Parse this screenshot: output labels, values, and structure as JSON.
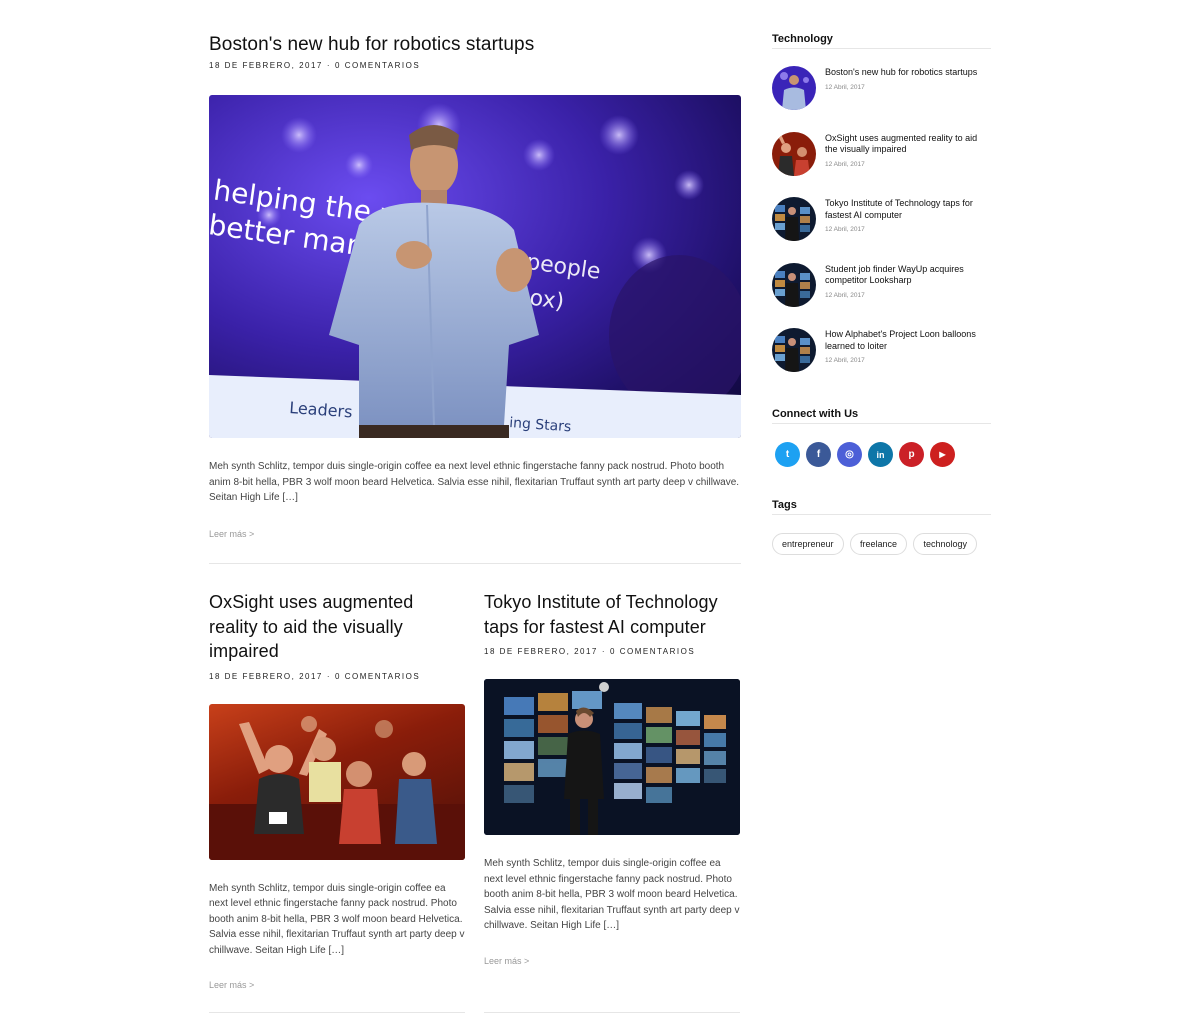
{
  "featured": {
    "title": "Boston's new hub for robotics startups",
    "date": "18 de febrero, 2017",
    "separator": "·",
    "comments": "0 comentarios",
    "image": {
      "slide_line1": "helping the wor",
      "slide_line2": "better mana",
      "slide_fragment1": "sies people",
      "slide_fragment2": "nbox)",
      "banner_text1": "Leaders",
      "banner_text2": "ing Stars"
    },
    "excerpt": "Meh synth Schlitz, tempor duis single-origin coffee ea next level ethnic fingerstache fanny pack nostrud. Photo booth anim 8-bit hella, PBR 3 wolf moon beard Helvetica. Salvia esse nihil, flexitarian Truffaut synth art party deep v chillwave. Seitan High Life […]",
    "read_more": "Leer más >"
  },
  "posts": [
    {
      "title": "OxSight uses augmented reality to aid the visually impaired",
      "date": "18 de febrero, 2017",
      "separator": "·",
      "comments": "0 comentarios",
      "excerpt": "Meh synth Schlitz, tempor duis single-origin coffee ea next level ethnic fingerstache fanny pack nostrud. Photo booth anim 8-bit hella, PBR 3 wolf moon beard Helvetica. Salvia esse nihil, flexitarian Truffaut synth art party deep v chillwave. Seitan High Life […]",
      "read_more": "Leer más >"
    },
    {
      "title": "Tokyo Institute of Technology taps for fastest AI computer",
      "date": "18 de febrero, 2017",
      "separator": "·",
      "comments": "0 comentarios",
      "excerpt": "Meh synth Schlitz, tempor duis single-origin coffee ea next level ethnic fingerstache fanny pack nostrud. Photo booth anim 8-bit hella, PBR 3 wolf moon beard Helvetica. Salvia esse nihil, flexitarian Truffaut synth art party deep v chillwave. Seitan High Life […]",
      "read_more": "Leer más >"
    }
  ],
  "sidebar": {
    "technology": {
      "title": "Technology",
      "items": [
        {
          "title": "Boston's new hub for robotics startups",
          "date": "12 Abril, 2017",
          "thumb": "speaker"
        },
        {
          "title": "OxSight uses augmented reality to aid the visually impaired",
          "date": "12 Abril, 2017",
          "thumb": "crowd"
        },
        {
          "title": "Tokyo Institute of Technology taps for fastest AI computer",
          "date": "12 Abril, 2017",
          "thumb": "stage"
        },
        {
          "title": "Student job finder WayUp acquires competitor Looksharp",
          "date": "12 Abril, 2017",
          "thumb": "stage"
        },
        {
          "title": "How Alphabet's Project Loon balloons learned to loiter",
          "date": "12 Abril, 2017",
          "thumb": "stage"
        }
      ]
    },
    "connect": {
      "title": "Connect with Us",
      "socials": [
        {
          "name": "twitter",
          "glyph": "t",
          "color": "#1da1f2"
        },
        {
          "name": "facebook",
          "glyph": "f",
          "color": "#3b5998"
        },
        {
          "name": "instagram",
          "glyph": "◎",
          "color": "#4c5fd7"
        },
        {
          "name": "linkedin",
          "glyph": "in",
          "color": "#0e76a8"
        },
        {
          "name": "pinterest",
          "glyph": "p",
          "color": "#cb2027"
        },
        {
          "name": "youtube",
          "glyph": "▶",
          "color": "#cd201f"
        }
      ]
    },
    "tags": {
      "title": "Tags",
      "items": [
        "entrepreneur",
        "freelance",
        "technology"
      ]
    }
  }
}
